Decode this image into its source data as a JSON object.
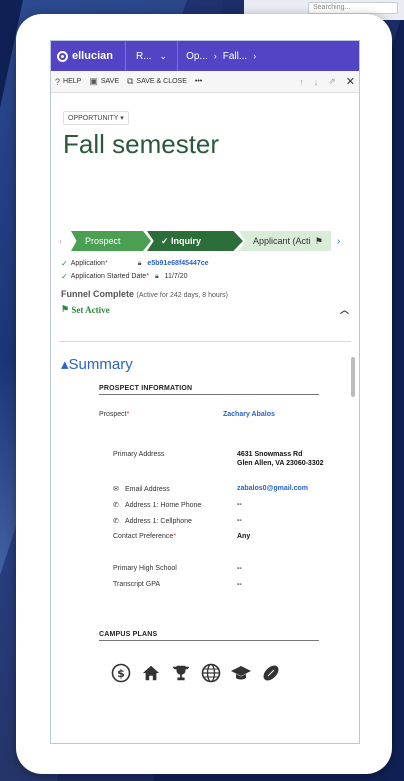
{
  "background": {
    "topright_pill": "Searching..."
  },
  "nav": {
    "brand": "ellucian",
    "segment": "R...",
    "crumb1": "Op...",
    "crumb2": "Fall..."
  },
  "commandbar": {
    "help": "HELP",
    "save": "SAVE",
    "save_close": "SAVE & CLOSE",
    "more": "•••"
  },
  "record": {
    "entity": "OPPORTUNITY",
    "title": "Fall semester"
  },
  "stages": [
    {
      "label": "Prospect"
    },
    {
      "label": "Inquiry"
    },
    {
      "label": "Applicant (Acti"
    }
  ],
  "process": {
    "application_label": "Application",
    "application_value": "e5b91e68f45447ce",
    "started_label": "Application Started Date",
    "started_value": "11/7/20",
    "funnel_label": "Funnel Complete",
    "funnel_detail": "(Active for 242 days, 8 hours)",
    "set_active": "Set Active"
  },
  "summary": {
    "title": "Summary",
    "prospect_info_header": "PROSPECT INFORMATION",
    "prospect_label": "Prospect",
    "prospect_value": "Zachary Abalos",
    "address_label": "Primary Address",
    "address_line1": "4631 Snowmass Rd",
    "address_line2": "Glen Allen, VA 23060-3302",
    "email_label": "Email Address",
    "email_value": "zabalos0@gmail.com",
    "home_phone_label": "Address 1: Home Phone",
    "home_phone_value": "--",
    "cellphone_label": "Address 1: Cellphone",
    "cellphone_value": "--",
    "contact_pref_label": "Contact Preference",
    "contact_pref_value": "Any",
    "high_school_label": "Primary High School",
    "high_school_value": "--",
    "gpa_label": "Transcript GPA",
    "gpa_value": "--",
    "campus_plans_header": "CAMPUS PLANS"
  },
  "campus_icons": [
    "dollar-icon",
    "home-icon",
    "trophy-icon",
    "globe-icon",
    "graduation-cap-icon",
    "football-icon"
  ],
  "colors": {
    "nav": "#5344c6",
    "title_green": "#2a5a3b",
    "stage_done": "#4b9f52",
    "stage_active": "#2c6e39",
    "stage_next": "#d9ecd8",
    "link_blue": "#2a62c9"
  }
}
